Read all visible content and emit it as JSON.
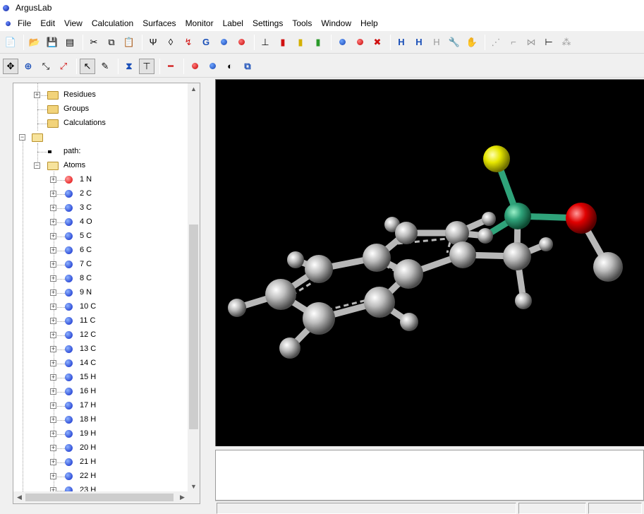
{
  "window": {
    "title": "ArgusLab",
    "app_icon": "arguslab-logo-icon"
  },
  "menu": [
    "File",
    "Edit",
    "View",
    "Calculation",
    "Surfaces",
    "Monitor",
    "Label",
    "Settings",
    "Tools",
    "Window",
    "Help"
  ],
  "toolbar1": {
    "icons": [
      "new-file-icon",
      "open-folder-icon",
      "save-icon",
      "print-preview-icon",
      "cut-icon",
      "copy-icon",
      "paste-icon",
      "bond-tool-icon",
      "atom-tool-icon",
      "torsion-icon",
      "refresh-calc-icon",
      "molecule-blue-icon",
      "molecule-red-icon",
      "stick-icon",
      "ball-red-icon",
      "ball-yellow-icon",
      "ball-green-icon",
      "atom-blue-icon",
      "atom-remove-icon",
      "atom-x-icon",
      "hydrogen-add-icon",
      "hydrogen-edit-icon",
      "hydrogen-gray-icon",
      "tools-icon",
      "hand-icon",
      "geometry-1-icon",
      "geometry-2-icon",
      "geometry-3-icon",
      "axes-icon",
      "geometry-4-icon"
    ],
    "hydrogen_label": "H"
  },
  "toolbar2": {
    "icons": [
      "move-icon",
      "rotate-icon",
      "zoom-icon",
      "select-icon",
      "pointer-arrow-icon",
      "pencil-icon",
      "bond-draw-icon",
      "tree-view-icon",
      "bond-line-icon",
      "atom-pair-icon",
      "atom-pair-2-icon",
      "rainbow-surface-icon",
      "box-icon"
    ]
  },
  "tree": {
    "residues": "Residues",
    "groups": "Groups",
    "calculations": "Calculations",
    "path": "path:",
    "atoms": "Atoms",
    "atom_list": [
      {
        "label": "1 N",
        "color": "red"
      },
      {
        "label": "2 C",
        "color": "blue"
      },
      {
        "label": "3 C",
        "color": "blue"
      },
      {
        "label": "4 O",
        "color": "blue"
      },
      {
        "label": "5 C",
        "color": "blue"
      },
      {
        "label": "6 C",
        "color": "blue"
      },
      {
        "label": "7 C",
        "color": "blue"
      },
      {
        "label": "8 C",
        "color": "blue"
      },
      {
        "label": "9 N",
        "color": "blue"
      },
      {
        "label": "10 C",
        "color": "blue"
      },
      {
        "label": "11 C",
        "color": "blue"
      },
      {
        "label": "12 C",
        "color": "blue"
      },
      {
        "label": "13 C",
        "color": "blue"
      },
      {
        "label": "14 C",
        "color": "blue"
      },
      {
        "label": "15 H",
        "color": "blue"
      },
      {
        "label": "16 H",
        "color": "blue"
      },
      {
        "label": "17 H",
        "color": "blue"
      },
      {
        "label": "18 H",
        "color": "blue"
      },
      {
        "label": "19 H",
        "color": "blue"
      },
      {
        "label": "20 H",
        "color": "blue"
      },
      {
        "label": "21 H",
        "color": "blue"
      },
      {
        "label": "22 H",
        "color": "blue"
      },
      {
        "label": "23 H",
        "color": "blue"
      }
    ]
  },
  "colors": {
    "viewport_bg": "#000000",
    "carbon": "#c8c8c8",
    "oxygen": "#e00000",
    "sulfur": "#e6e600",
    "phosphorus": "#2fa37a",
    "selected_atom": "#e00000",
    "atom_default": "#0a25c8"
  }
}
